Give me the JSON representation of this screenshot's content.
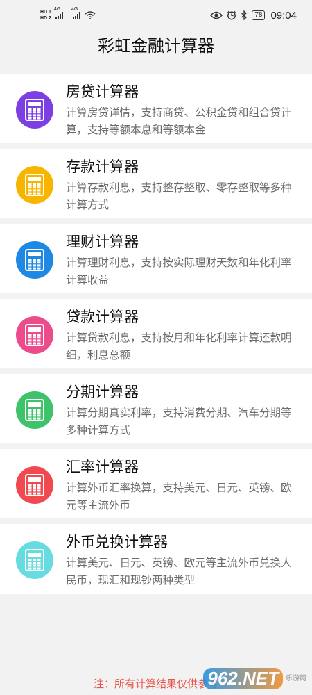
{
  "status": {
    "hd1": "HD 1",
    "hd2": "HD 2",
    "net1": "4G",
    "net2": "4G",
    "battery": "78",
    "time": "09:04",
    "icons": [
      "eye-icon",
      "alarm-icon",
      "bluetooth-icon",
      "wifi-icon"
    ]
  },
  "app": {
    "title": "彩虹金融计算器"
  },
  "calculators": [
    {
      "title": "房贷计算器",
      "desc": "计算房贷详情，支持商贷、公积金贷和组合贷计算，支持等额本息和等额本金",
      "color": "#7b3fe4"
    },
    {
      "title": "存款计算器",
      "desc": "计算存款利息，支持整存整取、零存整取等多种计算方式",
      "color": "#f7b500"
    },
    {
      "title": "理财计算器",
      "desc": "计算理财利息，支持按实际理财天数和年化利率计算收益",
      "color": "#1e88e5"
    },
    {
      "title": "贷款计算器",
      "desc": "计算贷款利息，支持按月和年化利率计算还款明细，利息总额",
      "color": "#ec4b8c"
    },
    {
      "title": "分期计算器",
      "desc": "计算分期真实利率，支持消费分期、汽车分期等多种计算方式",
      "color": "#3ec26a"
    },
    {
      "title": "汇率计算器",
      "desc": "计算外币汇率换算，支持美元、日元、英镑、欧元等主流外币",
      "color": "#f04a50"
    },
    {
      "title": "外币兑换计算器",
      "desc": "计算美元、日元、英镑、欧元等主流外币兑换人民币，现汇和现钞两种类型",
      "color": "#66dbe0"
    }
  ],
  "footer": {
    "note": "注：所有计算结果仅供参考"
  },
  "watermark": {
    "logo": "962",
    "domain": ".NET",
    "site": "乐游网"
  }
}
